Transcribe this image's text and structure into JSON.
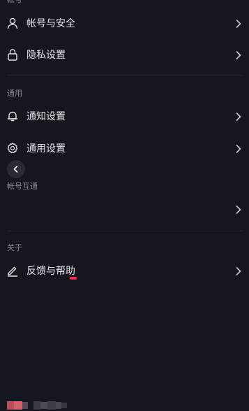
{
  "top_section": {
    "title_partial": "帐号"
  },
  "account_security": {
    "label": "帐号与安全",
    "icon": "user-icon"
  },
  "privacy": {
    "label": "隐私设置",
    "icon": "lock-icon"
  },
  "general": {
    "title": "通用",
    "notifications_label": "通知设置",
    "general_label": "通用设置"
  },
  "interop": {
    "title": "帐号互通"
  },
  "about": {
    "title": "关于",
    "feedback_label": "反馈与帮助"
  },
  "colors": {
    "background": "#16161e",
    "text": "#e6e6ea",
    "muted": "#8b8b96",
    "accent_dot": "#ff2b55"
  }
}
